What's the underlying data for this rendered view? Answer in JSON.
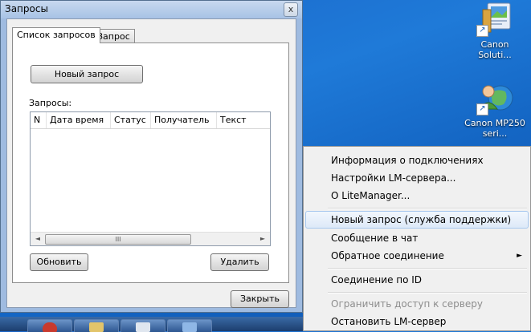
{
  "window": {
    "title": "Запросы",
    "close_glyph": "x",
    "tabs": [
      {
        "label": "Список запросов",
        "active": true
      },
      {
        "label": "Запрос",
        "active": false
      }
    ],
    "new_request_label": "Новый запрос",
    "requests_label": "Запросы:",
    "columns": [
      "N",
      "Дата время",
      "Статус",
      "Получатель",
      "Текст"
    ],
    "rows": [],
    "scroll_left": "◄",
    "scroll_right": "►",
    "scroll_grip": "III",
    "refresh_label": "Обновить",
    "delete_label": "Удалить",
    "close_label": "Закрыть"
  },
  "desktop": {
    "icons": [
      {
        "label": "Canon Soluti...",
        "icon": "canon-solution-menu-icon"
      },
      {
        "label": "Canon MP250 seri...",
        "icon": "canon-mp250-icon"
      }
    ],
    "shortcut_glyph": "↗"
  },
  "context_menu": {
    "items": [
      {
        "label": "Информация о подключениях",
        "enabled": true
      },
      {
        "label": "Настройки LM-сервера...",
        "enabled": true
      },
      {
        "label": "О LiteManager...",
        "enabled": true
      },
      {
        "label": "Новый запрос (служба поддержки)",
        "enabled": true,
        "highlighted": true
      },
      {
        "label": "Сообщение в чат",
        "enabled": true
      },
      {
        "label": "Обратное соединение",
        "enabled": true,
        "submenu_arrow": "►"
      },
      {
        "label": "Соединение по ID",
        "enabled": true
      },
      {
        "label": "Ограничить доступ к серверу",
        "enabled": false
      },
      {
        "label": "Остановить LM-сервер",
        "enabled": true
      }
    ]
  },
  "colors": {
    "desktop": "#1a6fce",
    "menu_highlight": "#dde9f8",
    "window_frame": "#9fbbe0"
  }
}
